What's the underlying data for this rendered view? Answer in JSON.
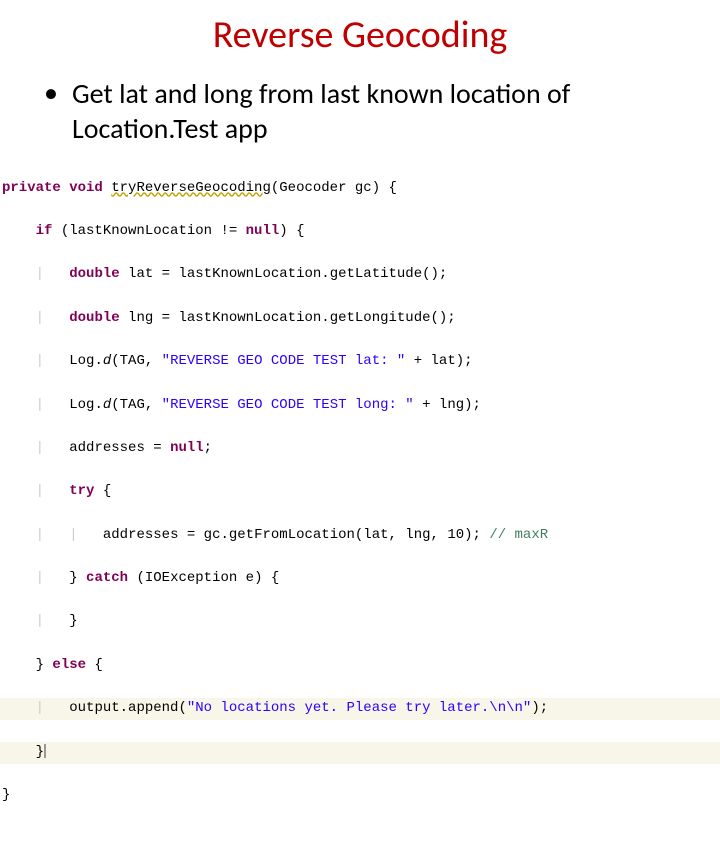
{
  "title": "Reverse Geocoding",
  "bullet": "Get lat and long from last known location of Location.Test app",
  "code": {
    "l1_kw1": "private void",
    "l1_name": "tryReverseGeocoding",
    "l1_args": "(Geocoder gc) {",
    "l2_kw": "if",
    "l2_rest": " (lastKnownLocation != ",
    "l2_null": "null",
    "l2_close": ") {",
    "l3_kw": "double",
    "l3_rest": " lat = lastKnownLocation.getLatitude();",
    "l4_kw": "double",
    "l4_rest": " lng = lastKnownLocation.getLongitude();",
    "l5a": "Log.",
    "l5b": "d",
    "l5c": "(TAG, ",
    "l5_str": "\"REVERSE GEO CODE TEST lat: \"",
    "l5d": " + lat);",
    "l6a": "Log.",
    "l6b": "d",
    "l6c": "(TAG, ",
    "l6_str": "\"REVERSE GEO CODE TEST long: \"",
    "l6d": " + lng);",
    "l7": "addresses = ",
    "l7_null": "null",
    "l7_end": ";",
    "l8_kw": "try",
    "l8_brace": " {",
    "l9": "addresses = gc.getFromLocation(lat, lng, 10); ",
    "l9_cmt": "// maxR",
    "l10a": "} ",
    "l10_kw": "catch",
    "l10b": " (IOException e) {",
    "l11": "}",
    "l12a": "} ",
    "l12_kw": "else",
    "l12b": " {",
    "l13a": "output.append(",
    "l13_str": "\"No locations yet. Please try later.\\n\\n\"",
    "l13b": ");",
    "l14": "}",
    "l15": "}"
  }
}
